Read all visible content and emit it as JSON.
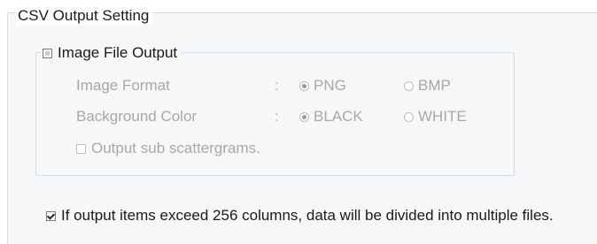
{
  "section_title": "CSV Output Setting",
  "image_output": {
    "label": "Image File Output",
    "checked": false,
    "enabled": true,
    "image_format": {
      "label": "Image Format",
      "separator": ":",
      "options": [
        "PNG",
        "BMP"
      ],
      "selected": "PNG"
    },
    "background_color": {
      "label": "Background Color",
      "separator": ":",
      "options": [
        "BLACK",
        "WHITE"
      ],
      "selected": "BLACK"
    },
    "sub_scattergrams": {
      "label": "Output sub scattergrams.",
      "checked": false,
      "enabled": false
    }
  },
  "divide_files": {
    "label": "If output items exceed 256 columns, data will be divided into multiple files.",
    "checked": true
  }
}
